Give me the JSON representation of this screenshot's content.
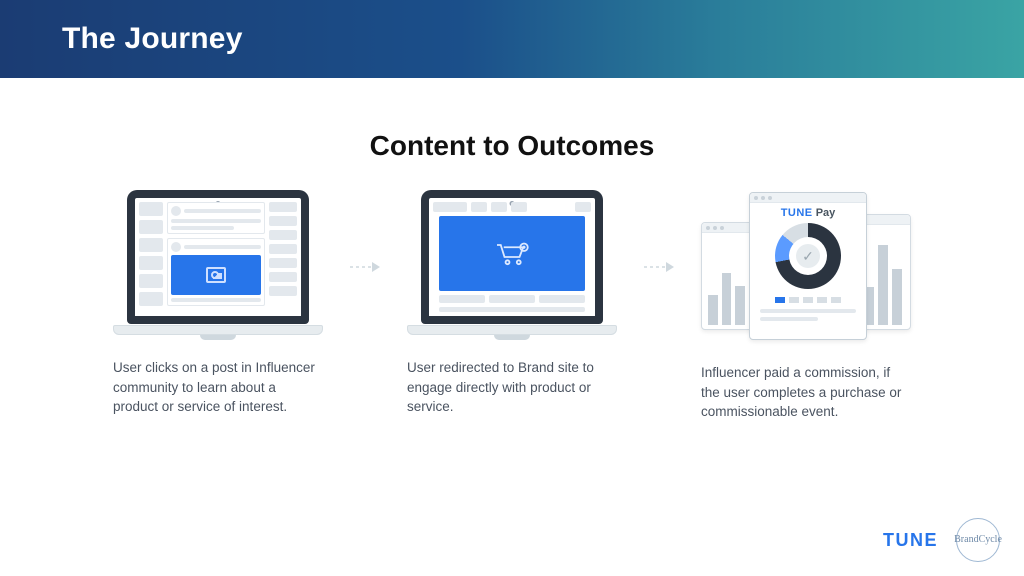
{
  "header": {
    "title": "The Journey"
  },
  "subtitle": "Content to Outcomes",
  "steps": [
    {
      "caption": "User clicks on a post in Influencer community to learn about a product or service of interest."
    },
    {
      "caption": "User redirected to Brand site to engage directly with product or service."
    },
    {
      "caption": "Influencer paid a commission, if the user completes a purchase or commissionable event."
    }
  ],
  "dashboard": {
    "brand_word": "TUNE",
    "brand_suffix": " Pay"
  },
  "footer": {
    "tune": "TUNE",
    "brandcycle": "BrandCycle"
  },
  "colors": {
    "accent": "#2775ea",
    "header_start": "#1b3c73",
    "header_end": "#3aa4a4"
  }
}
